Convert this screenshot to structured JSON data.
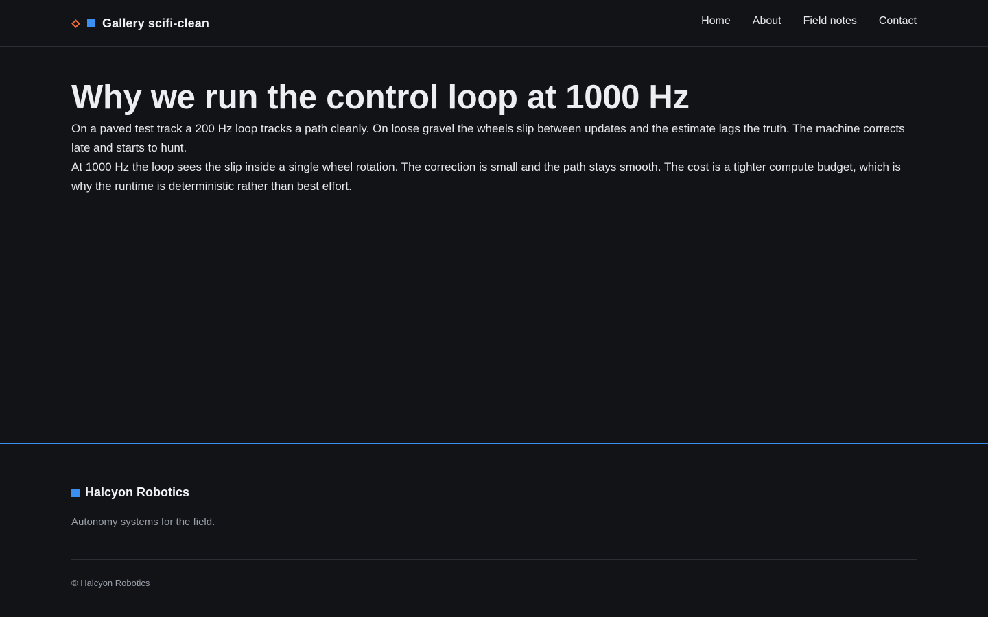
{
  "header": {
    "brand_name": "Gallery scifi-clean",
    "nav": [
      {
        "label": "Home"
      },
      {
        "label": "About"
      },
      {
        "label": "Field notes"
      },
      {
        "label": "Contact"
      }
    ]
  },
  "article": {
    "title": "Why we run the control loop at 1000 Hz",
    "paragraphs": [
      "On a paved test track a 200 Hz loop tracks a path cleanly. On loose gravel the wheels slip between updates and the estimate lags the truth. The machine corrects late and starts to hunt.",
      "At 1000 Hz the loop sees the slip inside a single wheel rotation. The correction is small and the path stays smooth. The cost is a tighter compute budget, which is why the runtime is deterministic rather than best effort."
    ]
  },
  "footer": {
    "brand_name": "Halcyon Robotics",
    "tagline": "Autonomy systems for the field.",
    "copyright": "© Halcyon Robotics"
  },
  "icons": {
    "brand_diamond": "diamond-outline-icon",
    "brand_square": "square-icon"
  },
  "colors": {
    "background": "#111317",
    "accent_blue": "#3b8ff0",
    "accent_orange": "#f26b3a",
    "text": "#e6e8ec",
    "muted_text": "#9aa0aa"
  }
}
